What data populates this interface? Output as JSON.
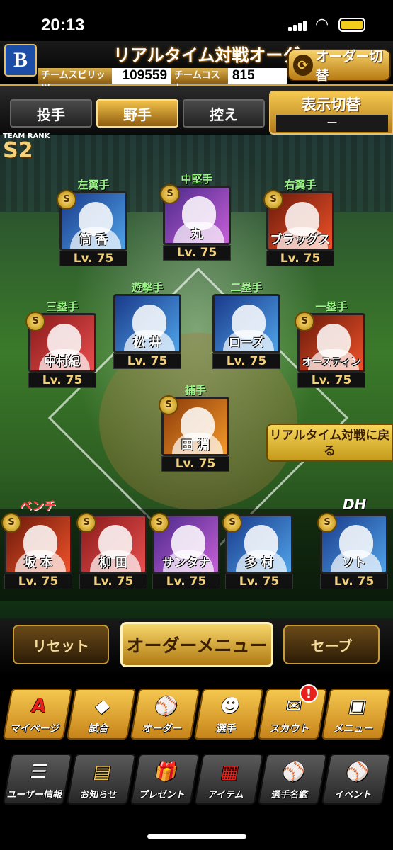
{
  "status": {
    "time": "20:13"
  },
  "header": {
    "logo": "B",
    "title": "リアルタイム対戦オーダー",
    "order_switch": "オーダー切替",
    "team_spirits_label": "チームスピリッツ",
    "team_spirits_value": "109559",
    "team_cost_label": "チームコスト",
    "team_cost_value": "815"
  },
  "tabs": {
    "pitcher": "投手",
    "fielder": "野手",
    "reserve": "控え",
    "active": "野手"
  },
  "display_switch": {
    "label": "表示切替",
    "value": "ー"
  },
  "team_rank": {
    "label": "TEAM RANK",
    "value": "S2"
  },
  "lineup": [
    {
      "pos": "左翼手",
      "name": "筒 香",
      "lv": "Lv. 75",
      "badge": "S"
    },
    {
      "pos": "中堅手",
      "name": "丸",
      "lv": "Lv. 75",
      "badge": "S"
    },
    {
      "pos": "右翼手",
      "name": "ブラッグス",
      "lv": "Lv. 75",
      "badge": "S"
    },
    {
      "pos": "遊撃手",
      "name": "松 井",
      "lv": "Lv. 75",
      "badge": ""
    },
    {
      "pos": "二塁手",
      "name": "ローズ",
      "lv": "Lv. 75",
      "badge": ""
    },
    {
      "pos": "三塁手",
      "name": "中村紀",
      "lv": "Lv. 75",
      "badge": "S"
    },
    {
      "pos": "一塁手",
      "name": "オースティン",
      "lv": "Lv. 75",
      "badge": "S"
    },
    {
      "pos": "捕手",
      "name": "田 淵",
      "lv": "Lv. 75",
      "badge": "S"
    }
  ],
  "back_button": "リアルタイム対戦に戻る",
  "bench_label": "ベンチ",
  "dh_label": "DH",
  "bench": [
    {
      "name": "坂 本",
      "lv": "Lv. 75",
      "badge": "S"
    },
    {
      "name": "柳 田",
      "lv": "Lv. 75",
      "badge": "S"
    },
    {
      "name": "サンタナ",
      "lv": "Lv. 75",
      "badge": "S"
    },
    {
      "name": "多 村",
      "lv": "Lv. 75",
      "badge": "S"
    },
    {
      "name": "ソト",
      "lv": "Lv. 75",
      "badge": "S"
    }
  ],
  "actions": {
    "reset": "リセット",
    "order_menu": "オーダーメニュー",
    "save": "セーブ"
  },
  "nav_main": [
    {
      "label": "マイページ",
      "icon": "A"
    },
    {
      "label": "試合",
      "icon": "◆"
    },
    {
      "label": "オーダー",
      "icon": "⚾"
    },
    {
      "label": "選手",
      "icon": "☻"
    },
    {
      "label": "スカウト",
      "icon": "✉"
    },
    {
      "label": "メニュー",
      "icon": "▣"
    }
  ],
  "nav_alert": "!",
  "nav_sub": [
    {
      "label": "ユーザー情報",
      "icon": "☰"
    },
    {
      "label": "お知らせ",
      "icon": "▤"
    },
    {
      "label": "プレゼント",
      "icon": "🎁"
    },
    {
      "label": "アイテム",
      "icon": "▦"
    },
    {
      "label": "選手名鑑",
      "icon": "⚾"
    },
    {
      "label": "イベント",
      "icon": "⚾"
    }
  ]
}
